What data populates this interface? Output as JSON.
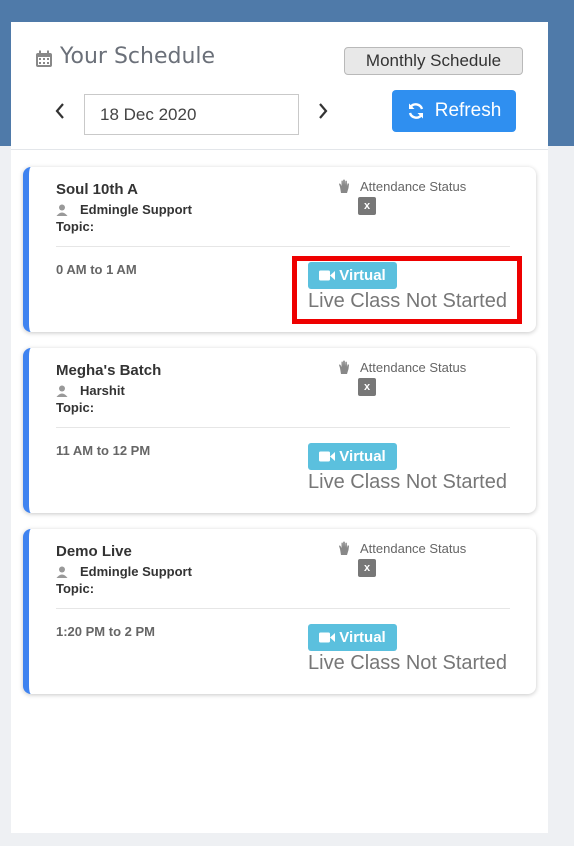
{
  "header": {
    "title": "Your Schedule",
    "monthly_button": "Monthly Schedule",
    "date_value": "18 Dec 2020",
    "refresh_label": "Refresh",
    "icons": [
      "calendar-icon",
      "chevron-left-icon",
      "chevron-right-icon",
      "refresh-icon"
    ]
  },
  "colors": {
    "top_band": "#4f7aa9",
    "refresh_button": "#2f8ff0",
    "card_accent": "#3f83f0",
    "virtual_badge": "#5bc0de",
    "highlight": "#ee0000"
  },
  "cards": [
    {
      "batch": "Soul 10th A",
      "teacher": "Edmingle Support",
      "topic_label": "Topic:",
      "attendance_label": "Attendance Status",
      "attendance_value": "x",
      "time": "0 AM to 1 AM",
      "mode": "Virtual",
      "status": "Live Class Not Started"
    },
    {
      "batch": "Megha's Batch",
      "teacher": "Harshit",
      "topic_label": "Topic:",
      "attendance_label": "Attendance Status",
      "attendance_value": "x",
      "time": "11 AM to 12 PM",
      "mode": "Virtual",
      "status": "Live Class Not Started"
    },
    {
      "batch": "Demo Live",
      "teacher": "Edmingle Support",
      "topic_label": "Topic:",
      "attendance_label": "Attendance Status",
      "attendance_value": "x",
      "time": "1:20 PM to 2 PM",
      "mode": "Virtual",
      "status": "Live Class Not Started"
    }
  ]
}
